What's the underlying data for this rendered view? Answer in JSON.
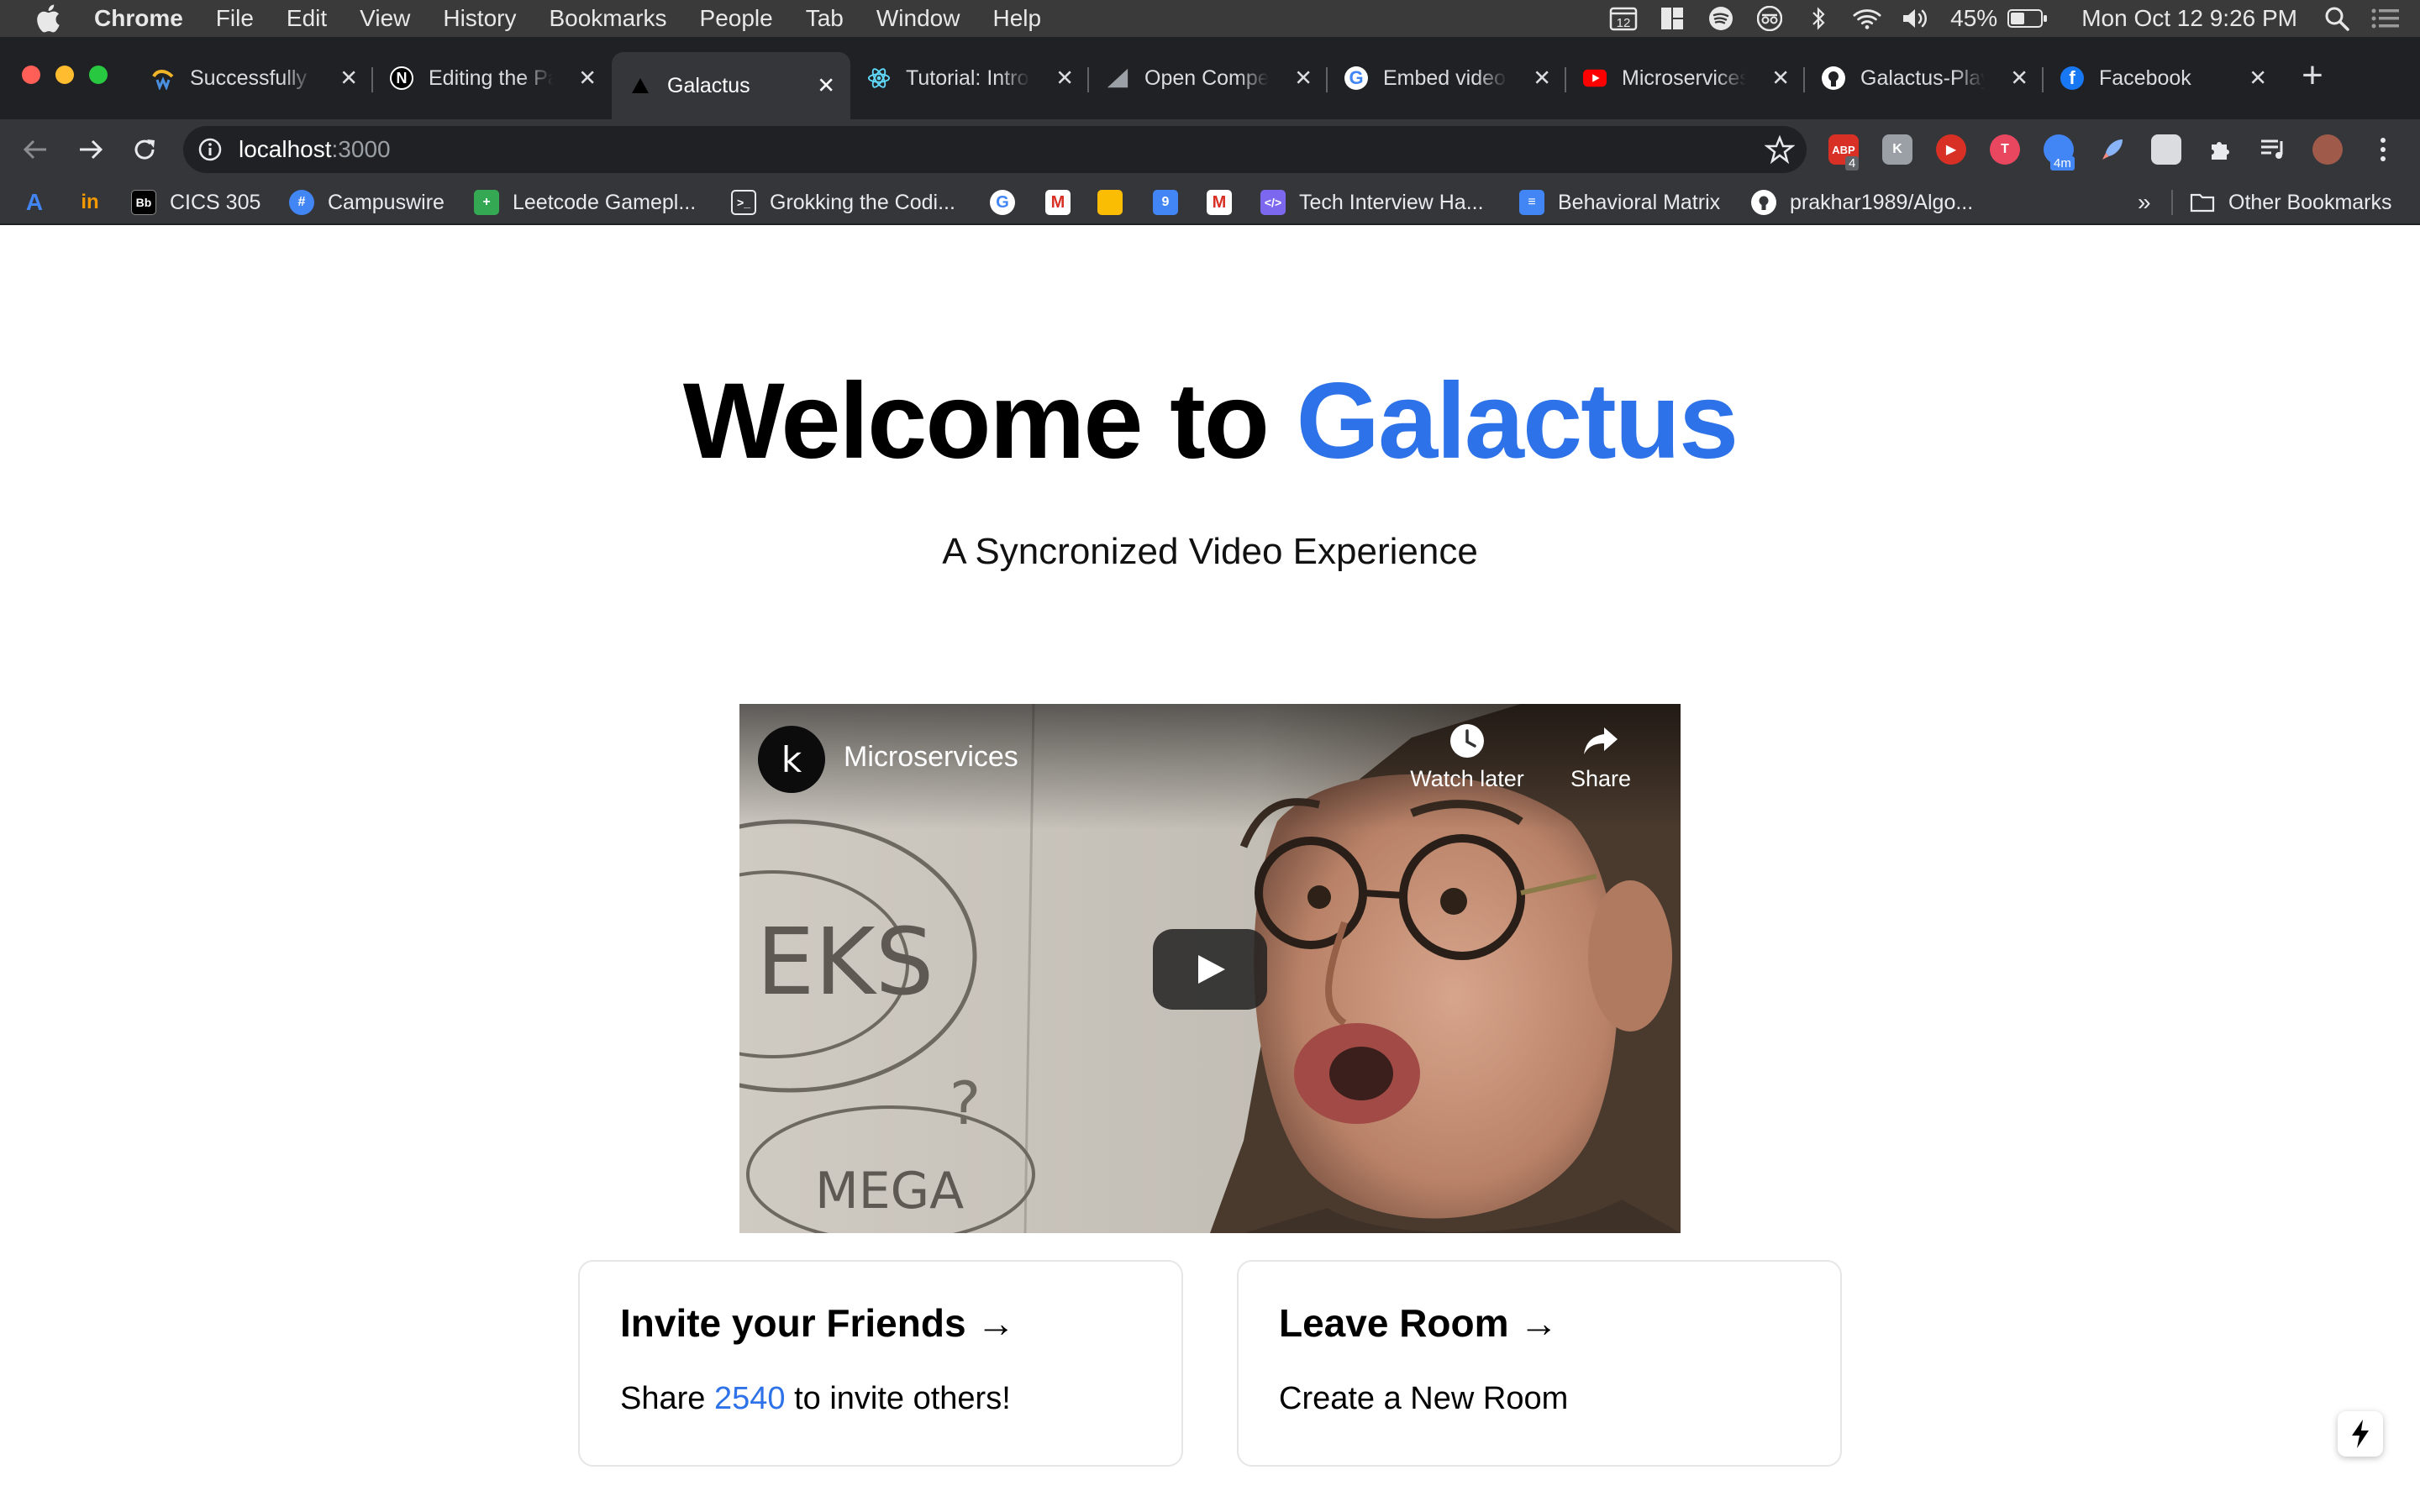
{
  "menubar": {
    "app_name": "Chrome",
    "menus": [
      "File",
      "Edit",
      "View",
      "History",
      "Bookmarks",
      "People",
      "Tab",
      "Window",
      "Help"
    ],
    "calendar_badge": "12",
    "battery": "45%",
    "datetime": "Mon Oct 12  9:26 PM"
  },
  "tabs": [
    {
      "title": "Successfully",
      "icon": "wave-icon",
      "color": "#f0b429"
    },
    {
      "title": "Editing the Pa",
      "icon": "notion-icon",
      "color": "#000000"
    },
    {
      "title": "Galactus",
      "icon": "triangle-icon",
      "color": "#000000",
      "active": true
    },
    {
      "title": "Tutorial: Intro",
      "icon": "react-icon",
      "color": "#61dafb"
    },
    {
      "title": "Open Compet",
      "icon": "chart-icon",
      "color": "#9aa0a6"
    },
    {
      "title": "Embed videos",
      "icon": "google-icon",
      "color": "#ffffff"
    },
    {
      "title": "Microservices",
      "icon": "youtube-icon",
      "color": "#ff0000"
    },
    {
      "title": "Galactus-Play",
      "icon": "github-icon",
      "color": "#ffffff"
    },
    {
      "title": "Facebook",
      "icon": "facebook-icon",
      "color": "#1877f2"
    }
  ],
  "toolbar": {
    "url_host": "localhost",
    "url_port": ":3000",
    "ext_badges": {
      "abp": "ABP",
      "abp_count": "4",
      "timer": "4m"
    }
  },
  "bookmarks": {
    "items": [
      "CICS 305",
      "Campuswire",
      "Leetcode Gamepl...",
      "Grokking the Codi...",
      "Tech Interview Ha...",
      "Behavioral Matrix",
      "prakhar1989/Algo..."
    ],
    "overflow": "»",
    "other": "Other Bookmarks",
    "bb_label": "Bb"
  },
  "page": {
    "title_prefix": "Welcome to ",
    "title_accent": "Galactus",
    "subtitle": "A Syncronized Video Experience",
    "accent_color": "#2d72e8"
  },
  "video": {
    "channel_initial": "k",
    "title": "Microservices",
    "watch_later": "Watch later",
    "share": "Share"
  },
  "cards": {
    "invite": {
      "heading": "Invite your Friends →",
      "text_before": "Share ",
      "room_code": "2540",
      "text_after": " to invite others!"
    },
    "leave": {
      "heading": "Leave Room →",
      "text": "Create a New Room"
    }
  }
}
